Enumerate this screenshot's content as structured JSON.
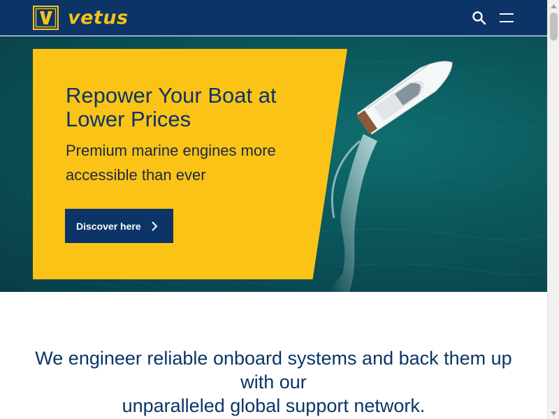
{
  "header": {
    "brand_name": "vetus",
    "logo_letter": "V",
    "icons": {
      "search": "search-icon",
      "menu": "hamburger-menu-icon"
    }
  },
  "hero": {
    "title": "Repower Your Boat at Lower Prices",
    "subtitle": "Premium marine engines more accessible than ever",
    "cta_label": "Discover here",
    "image": "aerial-speedboat-on-teal-sea"
  },
  "mission": {
    "line1": "We engineer reliable onboard systems and back them up with our",
    "line2": "unparalleled global support network."
  },
  "colors": {
    "navy": "#0c3466",
    "brand_yellow": "#fbc316",
    "sea": "#0b5a5e"
  }
}
